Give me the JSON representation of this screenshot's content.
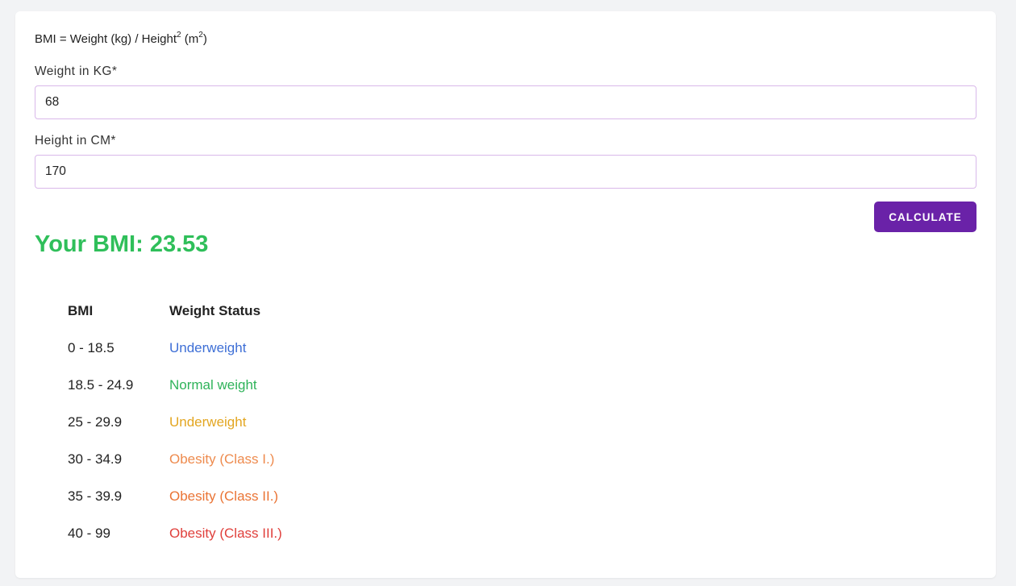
{
  "calculator": {
    "formula": {
      "prefix": "BMI = Weight (kg) / Height",
      "exp1": "2",
      "middle": " (m",
      "exp2": "2",
      "suffix": ")"
    },
    "weight": {
      "label": "Weight in KG*",
      "value": "68"
    },
    "height": {
      "label": "Height in CM*",
      "value": "170"
    },
    "calculate_label": "CALCULATE",
    "result_text": "Your BMI: 23.53"
  },
  "colors": {
    "accent": "#6a22a8",
    "result": "#2fbf5a",
    "input_border": "#d9b8ea"
  },
  "bmi_table": {
    "headers": {
      "range": "BMI",
      "status": "Weight Status"
    },
    "rows": [
      {
        "range": "0 - 18.5",
        "status": "Underweight",
        "color": "#3e6fd6"
      },
      {
        "range": "18.5 - 24.9",
        "status": "Normal weight",
        "color": "#2fb35a"
      },
      {
        "range": "25 - 29.9",
        "status": "Underweight",
        "color": "#e3a621"
      },
      {
        "range": "30 - 34.9",
        "status": "Obesity (Class I.)",
        "color": "#ee8b4e"
      },
      {
        "range": "35 - 39.9",
        "status": "Obesity (Class II.)",
        "color": "#ea7435"
      },
      {
        "range": "40 - 99",
        "status": "Obesity (Class III.)",
        "color": "#e0403c"
      }
    ]
  }
}
